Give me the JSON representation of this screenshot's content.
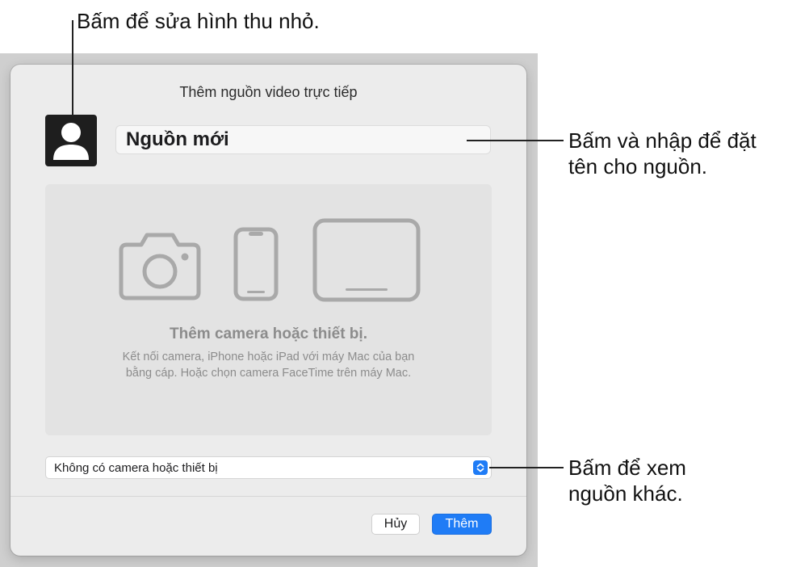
{
  "callouts": {
    "thumbnail": "Bấm để sửa hình thu nhỏ.",
    "name_line1": "Bấm và nhập để đặt",
    "name_line2": "tên cho nguồn.",
    "source_line1": "Bấm để xem",
    "source_line2": "nguồn khác."
  },
  "dialog": {
    "title": "Thêm nguồn video trực tiếp",
    "avatar_icon": "person-silhouette-icon",
    "name_value": "Nguồn mới",
    "device_area": {
      "icons": [
        "camera-icon",
        "iphone-icon",
        "ipad-icon"
      ],
      "heading": "Thêm camera hoặc thiết bị.",
      "description_line1": "Kết nối camera, iPhone hoặc iPad với máy Mac của bạn",
      "description_line2": "bằng cáp. Hoặc chọn camera FaceTime trên máy Mac."
    },
    "source_select": {
      "selected": "Không có camera hoặc thiết bị",
      "icon": "chevron-updown-icon"
    },
    "buttons": {
      "cancel": "Hủy",
      "add": "Thêm"
    }
  },
  "colors": {
    "accent": "#1f7cf6",
    "dialog_bg": "#ececec",
    "device_area_bg": "#e3e3e3",
    "muted_text": "#8c8c8c"
  }
}
